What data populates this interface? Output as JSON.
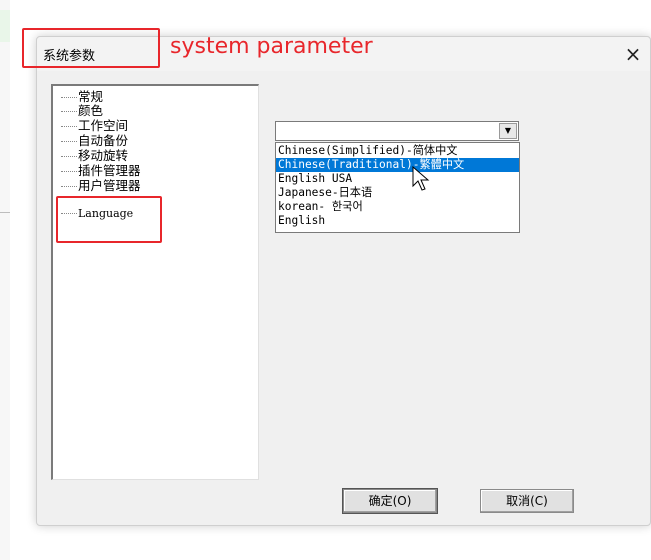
{
  "dialog": {
    "title": "系统参数",
    "close_glyph": "×"
  },
  "tree": {
    "items": [
      {
        "label": "常规"
      },
      {
        "label": "颜色"
      },
      {
        "label": "工作空间"
      },
      {
        "label": "自动备份"
      },
      {
        "label": "移动旋转"
      },
      {
        "label": "插件管理器"
      },
      {
        "label": "用户管理器"
      },
      {
        "label": "Language"
      }
    ]
  },
  "language": {
    "combo_value": "",
    "options": [
      {
        "label": "Chinese(Simplified)-简体中文",
        "selected": false
      },
      {
        "label": "Chinese(Traditional)-繁體中文",
        "selected": true
      },
      {
        "label": "English USA",
        "selected": false
      },
      {
        "label": "Japanese-日本语",
        "selected": false
      },
      {
        "label": "korean- 한국어",
        "selected": false
      },
      {
        "label": "English",
        "selected": false
      }
    ]
  },
  "buttons": {
    "ok_label": "确定(O)",
    "cancel_label": "取消(C)"
  },
  "annotation": {
    "label": "system parameter",
    "color": "#e8262b"
  },
  "colors": {
    "selection": "#0078d7",
    "dialog_bg": "#f0f0f0"
  }
}
